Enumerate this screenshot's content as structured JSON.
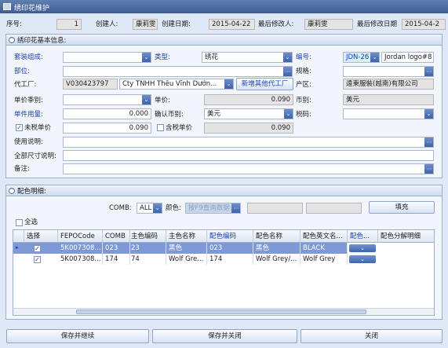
{
  "window": {
    "title": "绣印花维护"
  },
  "header": {
    "seq_label": "序号:",
    "seq_value": "1",
    "creator_label": "创建人:",
    "creator_value": "康莉雯",
    "create_date_label": "创建日期:",
    "create_date_value": "2015-04-22",
    "modifier_label": "最后修改人:",
    "modifier_value": "康莉雯",
    "modify_date_label": "最后修改日期",
    "modify_date_value": "2015-04-2"
  },
  "basic": {
    "title": "绣印花基本信息:",
    "set_label": "套装组成:",
    "set_value": "",
    "type_label": "类型:",
    "type_value": "绣花",
    "code_label": "编号:",
    "code_prefix": "JDN-26",
    "code_value": "Jordan logo#8",
    "part_label": "部位:",
    "part_value": "",
    "spec_label": "规格:",
    "spec_value": "",
    "factory_label": "代工厂:",
    "factory_code": "V030423797",
    "factory_name": "Cty TNHH Thêu Vĩnh Dướn...",
    "add_factory_label": "新增其他代工厂",
    "origin_label": "产区:",
    "origin_value": "遠東服裝(越南)有限公司",
    "price_season_label": "单价季别:",
    "price_season_value": "",
    "price_label": "单价:",
    "price_value": "0.090",
    "currency_label": "币别:",
    "currency_value": "美元",
    "usage_label": "单件用量:",
    "usage_value": "0.000",
    "confirm_currency_label": "确认币别:",
    "confirm_currency_value": "美元",
    "tax_code_label": "税码:",
    "tax_code_value": "",
    "untaxed_label": "未税单价",
    "untaxed_value": "0.090",
    "taxed_label": "含税单价",
    "taxed_value": "0.090",
    "instr_label": "使用说明:",
    "instr_value": "",
    "sizes_label": "全部尺寸说明:",
    "sizes_value": "",
    "remark_label": "备注:",
    "remark_value": ""
  },
  "color": {
    "title": "配色明细:",
    "comb_label": "COMB:",
    "comb_value": "ALL",
    "color_label": "颜色:",
    "color_placeholder": "按F9查询数据",
    "fill_label": "填充",
    "select_all_label": "全选",
    "columns": [
      "选择",
      "FEPOCode",
      "COMB",
      "主色编码",
      "主色名称",
      "配色编码",
      "配色名称",
      "配色英文名...",
      "配色...",
      "配色分解明细"
    ],
    "rows": [
      {
        "fepo": "5K007308...",
        "comb": "023",
        "main_code": "23",
        "main_name": "黑色",
        "color_code": "023",
        "color_name": "黑色",
        "color_en": "BLACK",
        "checked": true
      },
      {
        "fepo": "5K007308...",
        "comb": "174",
        "main_code": "74",
        "main_name": "Wolf Gre...",
        "color_code": "174",
        "color_name": "Wolf Grey/...",
        "color_en": "Wolf Grey",
        "checked": true
      }
    ]
  },
  "footer": {
    "save_continue": "保存并继续",
    "save_close": "保存并关闭",
    "close": "关闭"
  },
  "glyphs": {
    "dropdown": "⌄",
    "dots": "⋯",
    "check": "✓",
    "row_marker": "▸",
    "collapse": "^"
  }
}
